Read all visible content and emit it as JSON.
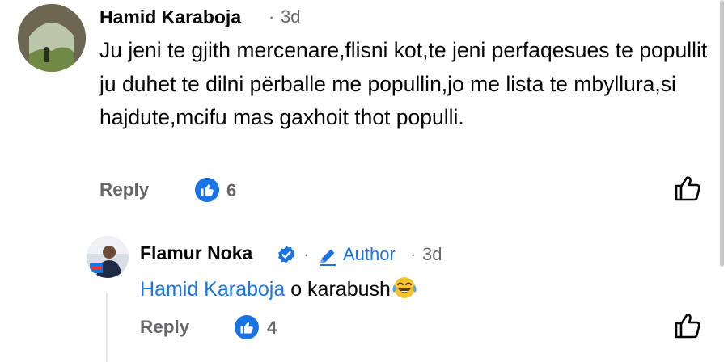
{
  "comment": {
    "author": "Hamid Karaboja",
    "separator": "·",
    "time": "3d",
    "text": "Ju jeni te gjith mercenare,flisni kot,te jeni perfaqesues te popullit ju duhet te dilni përballe me popullin,jo me lista te mbyllura,si hajdute,mcifu mas gaxhoit thot populli.",
    "reply_label": "Reply",
    "like_count": "6",
    "avatar_icon": "ruins-photo-avatar"
  },
  "reply": {
    "author": "Flamur Noka",
    "verified_icon": "verified-badge-icon",
    "dot1": "·",
    "author_badge": "Author",
    "dot2": "·",
    "time": "3d",
    "mention": "Hamid Karaboja",
    "text": " o karabush",
    "emoji": "tears-of-joy-emoji",
    "reply_label": "Reply",
    "like_count": "4",
    "avatar_icon": "speaker-photo-avatar"
  },
  "colors": {
    "accent": "#1b74e4",
    "secondary_text": "#65676b",
    "primary_text": "#050505"
  }
}
